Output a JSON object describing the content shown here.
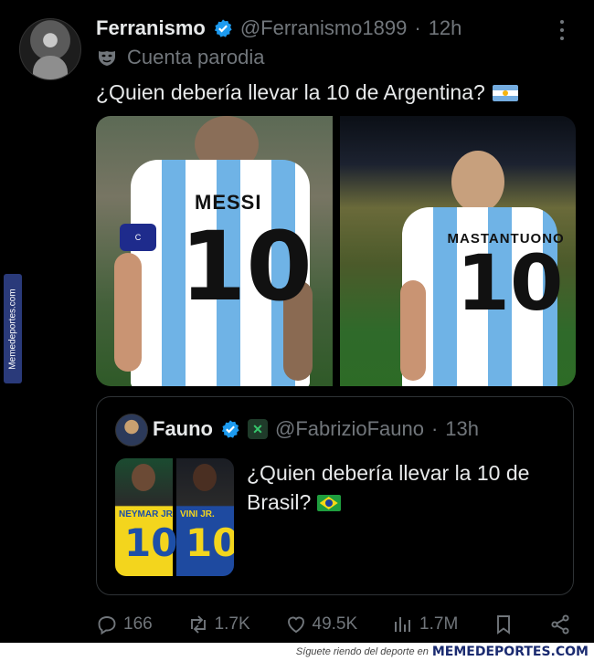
{
  "tweet": {
    "author_name": "Ferranismo",
    "handle": "@Ferranismo1899",
    "separator": "·",
    "time": "12h",
    "parody_label": "Cuenta parodia",
    "text": "¿Quien debería llevar la 10 de Argentina?",
    "media": [
      {
        "jersey_name": "MESSI",
        "jersey_number": "10",
        "armband": "C"
      },
      {
        "jersey_name": "MASTANTUONO",
        "jersey_number": "10"
      }
    ]
  },
  "quoted": {
    "author_name": "Fauno",
    "handle": "@FabrizioFauno",
    "separator": "·",
    "time": "13h",
    "text": "¿Quien debería llevar la 10 de Brasil?",
    "media": [
      {
        "jersey_name": "NEYMAR JR",
        "jersey_number": "10"
      },
      {
        "jersey_name": "VINI JR.",
        "jersey_number": "10"
      }
    ]
  },
  "actions": {
    "replies": "166",
    "reposts": "1.7K",
    "likes": "49.5K",
    "views": "1.7M"
  },
  "watermark": {
    "side": "Memedeportes.com",
    "footer_text": "Síguete riendo del deporte en",
    "footer_brand": "MEMEDEPORTES.COM"
  },
  "colors": {
    "background": "#000000",
    "text": "#e7e9ea",
    "muted": "#71767b",
    "verified": "#1d9bf0",
    "border": "#2f3336"
  }
}
